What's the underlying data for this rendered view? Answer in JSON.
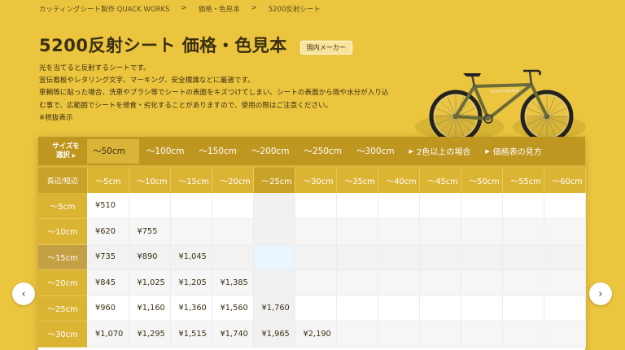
{
  "breadcrumb": [
    "カッティングシート製作 QUACK WORKS",
    "価格・色見本",
    "5200反射シート"
  ],
  "breadcrumb_sep": ">",
  "title": "5200反射シート 価格・色見本",
  "badge": "国内メーカー",
  "description": [
    "光を当てると反射するシートです。",
    "宣伝看板やレタリング文字、マーキング、安全標識などに最適です。",
    "車輌等に貼った場合、洗車やブラシ等でシートの表面をキズつけてしまい、シートの表面から雨や水分が入り込",
    "む事で、広範囲でシートを侵食・劣化することがありますので、使用の際はご注意ください。",
    "※税抜表示"
  ],
  "bike_label": "QUACK WORKS",
  "tabs": {
    "size_label_line1": "サイズを",
    "size_label_line2": "選択",
    "items": [
      "〜50cm",
      "〜100cm",
      "〜150cm",
      "〜200cm",
      "〜250cm",
      "〜300cm"
    ],
    "active_index": 0,
    "link_multi": "2色以上の場合",
    "link_guide": "価格表の見方"
  },
  "table": {
    "corner": "長辺/短辺",
    "columns": [
      "〜5cm",
      "〜10cm",
      "〜15cm",
      "〜20cm",
      "〜25cm",
      "〜30cm",
      "〜35cm",
      "〜40cm",
      "〜45cm",
      "〜50cm",
      "〜55cm",
      "〜60cm"
    ],
    "highlight_column": 4,
    "highlight_row": 2,
    "rows": [
      {
        "label": "〜5cm",
        "cells": [
          "¥510",
          "",
          "",
          "",
          "",
          "",
          "",
          "",
          "",
          "",
          "",
          ""
        ]
      },
      {
        "label": "〜10cm",
        "cells": [
          "¥620",
          "¥755",
          "",
          "",
          "",
          "",
          "",
          "",
          "",
          "",
          "",
          ""
        ]
      },
      {
        "label": "〜15cm",
        "cells": [
          "¥735",
          "¥890",
          "¥1,045",
          "",
          "",
          "",
          "",
          "",
          "",
          "",
          "",
          ""
        ]
      },
      {
        "label": "〜20cm",
        "cells": [
          "¥845",
          "¥1,025",
          "¥1,205",
          "¥1,385",
          "",
          "",
          "",
          "",
          "",
          "",
          "",
          ""
        ]
      },
      {
        "label": "〜25cm",
        "cells": [
          "¥960",
          "¥1,160",
          "¥1,360",
          "¥1,560",
          "¥1,760",
          "",
          "",
          "",
          "",
          "",
          "",
          ""
        ]
      },
      {
        "label": "〜30cm",
        "cells": [
          "¥1,070",
          "¥1,295",
          "¥1,515",
          "¥1,740",
          "¥1,965",
          "¥2,190",
          "",
          "",
          "",
          "",
          "",
          ""
        ]
      }
    ]
  },
  "nav": {
    "prev": "‹",
    "next": "›"
  },
  "colors": {
    "background": "#ecc53f",
    "tabbar": "#bf961f",
    "header": "#dcb434",
    "highlight": "#c9a22a"
  }
}
